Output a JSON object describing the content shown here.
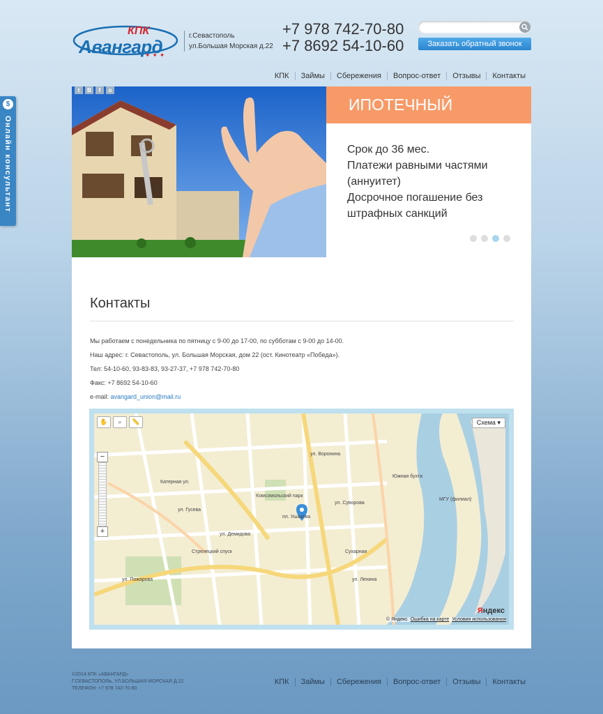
{
  "side_tab": {
    "icon": "dollar-icon",
    "label": "Онлайн консультант"
  },
  "logo": {
    "kpk": "КПК",
    "brand": "Авангард"
  },
  "address": {
    "city": "г.Севастополь",
    "street": "ул.Большая Морская д.22"
  },
  "phones": [
    "+7 978 742-70-80",
    "+7 8692 54-10-60"
  ],
  "search": {
    "placeholder": "",
    "icon": "search-icon"
  },
  "callback_label": "Заказать обратный звонок",
  "nav": [
    "КПК",
    "Займы",
    "Сбережения",
    "Вопрос-ответ",
    "Отзывы",
    "Контакты"
  ],
  "social": [
    "twitter",
    "vk",
    "facebook",
    "odnoklassniki"
  ],
  "slider": {
    "title": "ИПОТЕЧНЫЙ",
    "lines": [
      "Срок до 36 мес.",
      "Платежи равными частями (аннуитет)",
      "Досрочное погашение без штрафных санкций"
    ],
    "active_dot": 3,
    "dot_count": 4
  },
  "contacts": {
    "title": "Контакты",
    "hours": "Мы работаем с понедельника по пятницу с 9-00 до 17-00, по субботам с 9-00 до 14-00.",
    "address": "Наш адрес: г. Севастополь, ул. Большая Морская, дом 22 (ост. Кинотеатр «Победа»).",
    "phones": "Тел: 54-10-60, 93-83-83, 93-27-37, +7 978 742-70-80",
    "fax": "Факс: +7 8692 54-10-60",
    "email_label": "e-mail: ",
    "email": "avangard_union@mail.ru"
  },
  "map": {
    "type_label": "Схема",
    "labels": [
      "Катерная ул.",
      "Комсомольский парк",
      "Южная бухта",
      "МГУ (филиал)",
      "ул. Пожарова",
      "Стрелецкий спуск",
      "ул. Гусева",
      "ул. Демидова",
      "пл. Ушакова",
      "ул. Воронина",
      "ул. Суворова",
      "Сухарная",
      "ул. Ленина"
    ],
    "copyright": "© Яндекс",
    "error_link": "Ошибка на карте",
    "terms_link": "Условия использования",
    "brand": "Яндекс"
  },
  "footer": {
    "copyright": "©2014 КПК «АВАНГАРД»",
    "address": "г.СЕВАСТОПОЛЬ, УЛ.БОЛЬШАЯ МОРСКАЯ Д.22",
    "phone": "ТЕЛЕФОН: +7 978 742-70-80",
    "nav": [
      "КПК",
      "Займы",
      "Сбережения",
      "Вопрос-ответ",
      "Отзывы",
      "Контакты"
    ]
  },
  "colors": {
    "accent": "#2b86cf",
    "slider_head": "#f79a68",
    "brand_red": "#d7262d",
    "brand_blue": "#1a6fb3"
  }
}
